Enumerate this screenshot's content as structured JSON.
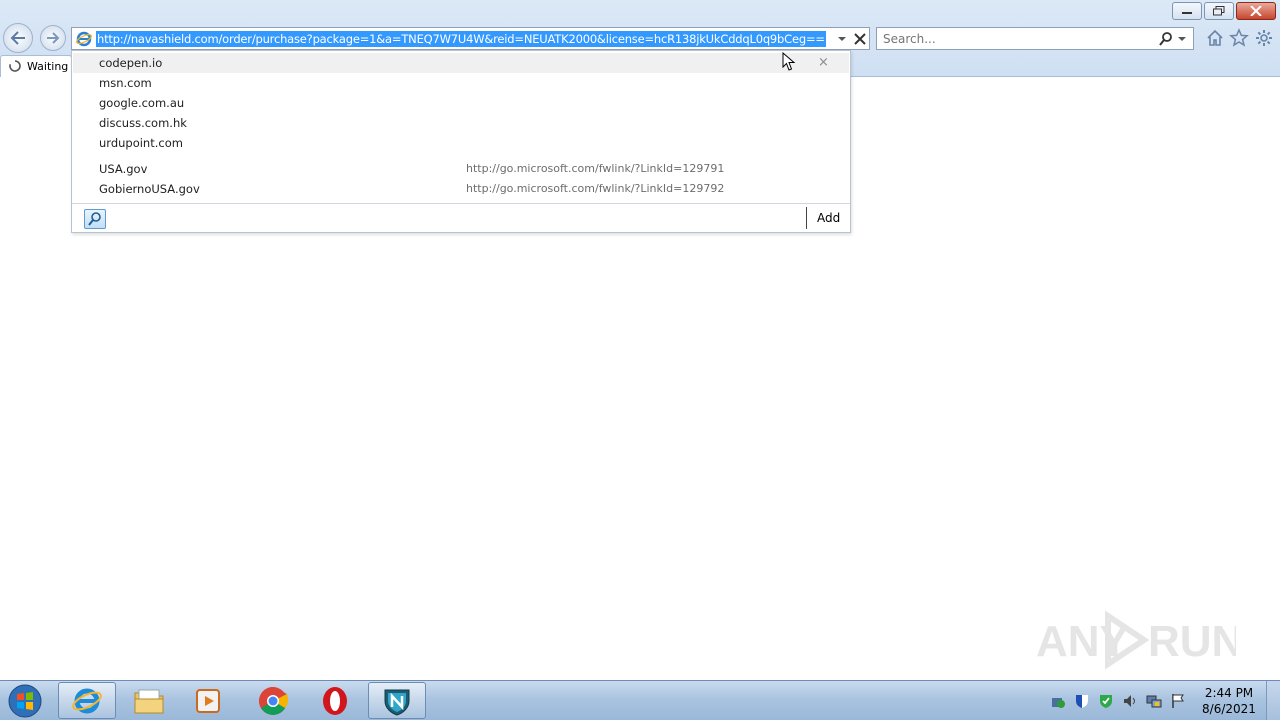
{
  "browser": {
    "address_url": "http://navashield.com/order/purchase?package=1&a=TNEQ7W7U4W&reid=NEUATK2000&license=hcR138jkUkCddqL0q9bCeg==",
    "search_placeholder": "Search...",
    "tab_title": "Waiting for navashield.com",
    "tab_title_visible": "Waiting"
  },
  "autocomplete": {
    "history": [
      {
        "label": "codepen.io"
      },
      {
        "label": "msn.com"
      },
      {
        "label": "google.com.au"
      },
      {
        "label": "discuss.com.hk"
      },
      {
        "label": "urdupoint.com"
      }
    ],
    "favorites": [
      {
        "label": "USA.gov",
        "url": "http://go.microsoft.com/fwlink/?LinkId=129791"
      },
      {
        "label": "GobiernoUSA.gov",
        "url": "http://go.microsoft.com/fwlink/?LinkId=129792"
      }
    ],
    "delete_glyph": "×",
    "add_label": "Add"
  },
  "watermark": {
    "text": "ANY RUN"
  },
  "taskbar": {
    "clock_time": "2:44 PM",
    "clock_date": "8/6/2021"
  },
  "colors": {
    "selection": "#3399ff",
    "frame": "#dbe8f6"
  }
}
